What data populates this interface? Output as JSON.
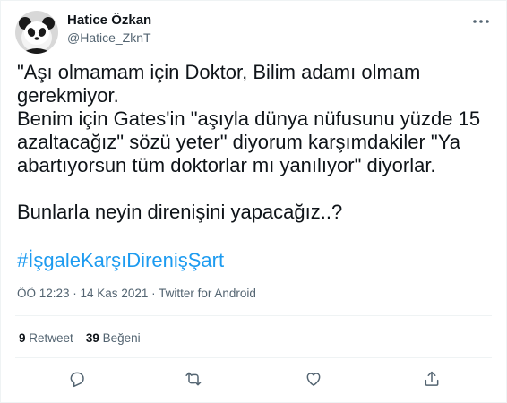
{
  "author": {
    "display_name": "Hatice Özkan",
    "handle": "@Hatice_ZknT",
    "avatar_icon": "panda-avatar"
  },
  "tweet": {
    "lines": [
      "\"Aşı olmamam için Doktor, Bilim adamı olmam gerekmiyor.",
      "Benim için Gates'in \"aşıyla dünya nüfusunu yüzde 15 azaltacağız\" sözü yeter\" diyorum karşımdakiler \"Ya abartıyorsun tüm doktorlar mı yanılıyor\" diyorlar.",
      "",
      "Bunlarla neyin direnişini yapacağız..?"
    ],
    "hashtag": "#İşgaleKarşıDirenişŞart",
    "timestamp": "ÖÖ 12:23 · 14 Kas 2021 · Twitter for Android"
  },
  "stats": {
    "retweets_count": "9",
    "retweets_label": "Retweet",
    "likes_count": "39",
    "likes_label": "Beğeni"
  },
  "actions": [
    "reply-icon",
    "retweet-icon",
    "like-icon",
    "share-icon"
  ],
  "colors": {
    "link": "#1d9bf0",
    "secondary_text": "#536471",
    "divider": "#eff3f4"
  }
}
